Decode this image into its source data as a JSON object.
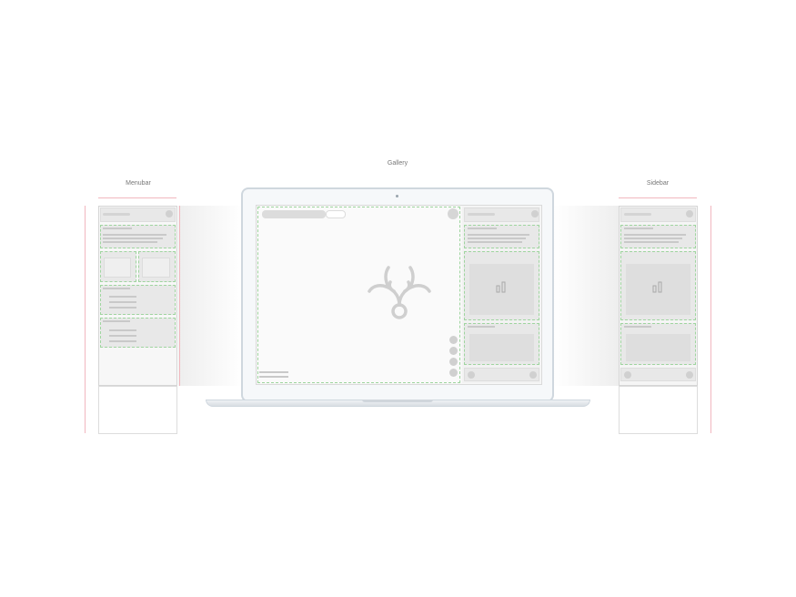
{
  "gallery": {
    "title": "Gallery"
  },
  "menubar": {
    "title": "Menubar"
  },
  "sidebar": {
    "title": "Sidebar"
  },
  "icons": {
    "logo": "antler-logo-icon",
    "chart": "bar-chart-icon",
    "camera": "camera-dot-icon"
  },
  "colors": {
    "guide_lines": "#f2b7bf",
    "card_dash": "#9fd59f",
    "frame": "#cfd7de"
  }
}
